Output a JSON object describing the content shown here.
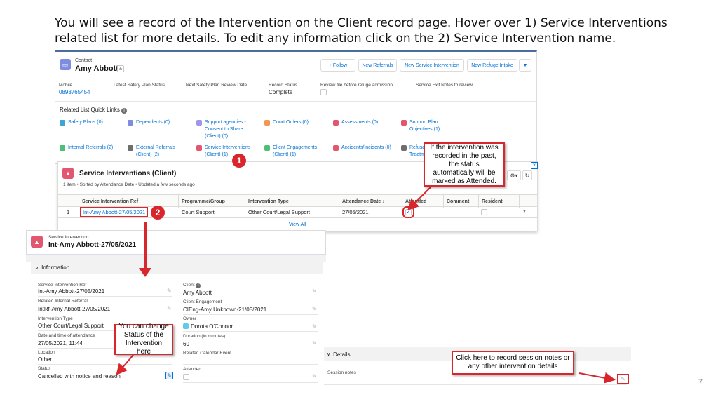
{
  "heading": "You will see a record of the Intervention on the Client record page. Hover over 1) Service Interventions related list for more details. To edit any information click on the 2) Service Intervention name.",
  "contact": {
    "object_label": "Contact",
    "name": "Amy Abbott",
    "buttons": {
      "follow": "Follow",
      "new_referrals": "New Referrals",
      "new_service_intervention": "New Service Intervention",
      "new_refuge_intake": "New Refuge Intake"
    },
    "fields": {
      "mobile_label": "Mobile",
      "mobile_value": "0893765454",
      "safety_plan_status_label": "Latest Safety Plan Status",
      "next_review_label": "Next Safety Plan Review Date",
      "record_status_label": "Record Status",
      "record_status_value": "Complete",
      "review_file_label": "Review file before refuge admission",
      "exit_notes_label": "Service Exit Notes to review"
    }
  },
  "quick_links": {
    "title": "Related List Quick Links",
    "items": {
      "safety_plans": "Safety Plans (0)",
      "dependents": "Dependents (0)",
      "support_agencies": "Support agencies - Consent to Share (Client) (0)",
      "court_orders": "Court Orders (0)",
      "assessments": "Assessments (0)",
      "support_plan": "Support Plan Objectives (1)",
      "internal_referrals": "Internal Referrals (2)",
      "external_referrals": "External Referrals (Client) (2)",
      "service_interventions": "Service Interventions (Client) (1)",
      "client_engagements": "Client Engagements (Client) (1)",
      "accidents": "Accidents/Incidents (0)",
      "refusals": "Refusal Treatme"
    }
  },
  "related_list": {
    "title": "Service Interventions (Client)",
    "subtitle": "1 item • Sorted by Attendance Date • Updated a few seconds ago",
    "columns": {
      "ref": "Service Intervention Ref",
      "programme": "Programme/Group",
      "type": "Intervention Type",
      "date": "Attendance Date ↓",
      "attended": "Attended",
      "comment": "Comment",
      "resident": "Resident"
    },
    "row": {
      "num": "1",
      "ref": "Int-Amy Abbott-27/05/2021",
      "programme": "Court Support",
      "type": "Other Court/Legal Support",
      "date": "27/05/2021",
      "attended": true
    },
    "view_all": "View All"
  },
  "record": {
    "object_label": "Service Intervention",
    "name": "Int-Amy Abbott-27/05/2021",
    "section_information": "Information",
    "section_details": "Details",
    "fields": {
      "ref_label": "Service Intervention Ref",
      "ref_value": "Int-Amy Abbott-27/05/2021",
      "internal_referral_label": "Related Internal Referral",
      "internal_referral_value": "IntRf-Amy Abbott-27/05/2021",
      "type_label": "Intervention Type",
      "type_value": "Other Court/Legal Support",
      "datetime_label": "Date and time of attendance",
      "datetime_value": "27/05/2021, 11:44",
      "location_label": "Location",
      "location_value": "Other",
      "status_label": "Status",
      "status_value": "Cancelled with notice and reason",
      "client_label": "Client",
      "client_value": "Amy Abbott",
      "engagement_label": "Client Engagement",
      "engagement_value": "CIEng-Amy Unknown-21/05/2021",
      "owner_label": "Owner",
      "owner_value": "Dorota O'Connor",
      "duration_label": "Duration (in minutes)",
      "duration_value": "60",
      "calendar_label": "Related Calendar Event",
      "attended_label": "Attended",
      "session_notes_label": "Session notes"
    }
  },
  "callouts": {
    "attended": "If the intervention was recorded in the past, the status automatically will be marked as Attended.",
    "status": "You can change Status of the Intervention here",
    "session_notes": "Click here to record session notes or any other intervention details"
  },
  "badges": {
    "one": "1",
    "two": "2"
  },
  "page_number": "7",
  "colors": {
    "accent": "#0070d2",
    "callout_red": "#d9262c",
    "icon_pink": "#e3566f"
  }
}
